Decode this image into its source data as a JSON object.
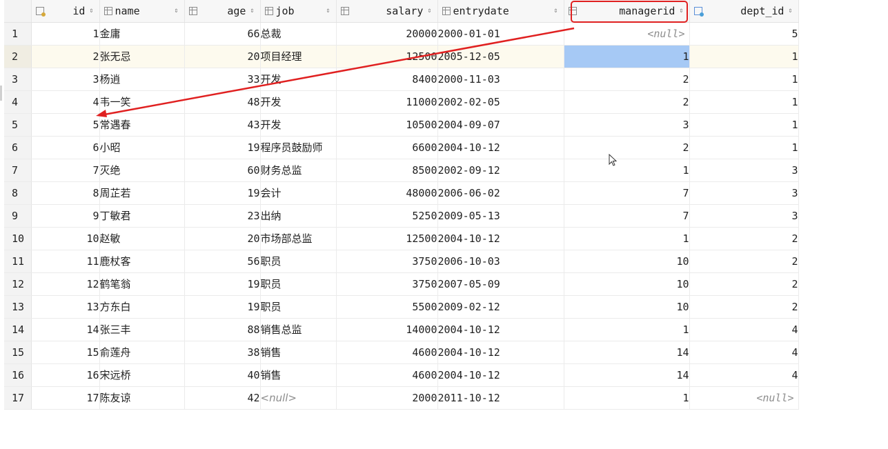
{
  "columns": [
    {
      "name": "id",
      "icon": "primary-key-column-icon"
    },
    {
      "name": "name",
      "icon": "column-icon"
    },
    {
      "name": "age",
      "icon": "column-icon"
    },
    {
      "name": "job",
      "icon": "column-icon"
    },
    {
      "name": "salary",
      "icon": "column-icon"
    },
    {
      "name": "entrydate",
      "icon": "column-icon"
    },
    {
      "name": "managerid",
      "icon": "column-icon"
    },
    {
      "name": "dept_id",
      "icon": "foreign-key-column-icon"
    }
  ],
  "sort_glyph": "⇕",
  "rows": [
    [
      "1",
      "1",
      "金庸",
      "66",
      "总裁",
      "20000",
      "2000-01-01",
      "<null>",
      "5"
    ],
    [
      "2",
      "2",
      "张无忌",
      "20",
      "项目经理",
      "12500",
      "2005-12-05",
      "1",
      "1"
    ],
    [
      "3",
      "3",
      "杨逍",
      "33",
      "开发",
      "8400",
      "2000-11-03",
      "2",
      "1"
    ],
    [
      "4",
      "4",
      "韦一笑",
      "48",
      "开发",
      "11000",
      "2002-02-05",
      "2",
      "1"
    ],
    [
      "5",
      "5",
      "常遇春",
      "43",
      "开发",
      "10500",
      "2004-09-07",
      "3",
      "1"
    ],
    [
      "6",
      "6",
      "小昭",
      "19",
      "程序员鼓励师",
      "6600",
      "2004-10-12",
      "2",
      "1"
    ],
    [
      "7",
      "7",
      "灭绝",
      "60",
      "财务总监",
      "8500",
      "2002-09-12",
      "1",
      "3"
    ],
    [
      "8",
      "8",
      "周芷若",
      "19",
      "会计",
      "48000",
      "2006-06-02",
      "7",
      "3"
    ],
    [
      "9",
      "9",
      "丁敏君",
      "23",
      "出纳",
      "5250",
      "2009-05-13",
      "7",
      "3"
    ],
    [
      "10",
      "10",
      "赵敏",
      "20",
      "市场部总监",
      "12500",
      "2004-10-12",
      "1",
      "2"
    ],
    [
      "11",
      "11",
      "鹿杖客",
      "56",
      "职员",
      "3750",
      "2006-10-03",
      "10",
      "2"
    ],
    [
      "12",
      "12",
      "鹤笔翁",
      "19",
      "职员",
      "3750",
      "2007-05-09",
      "10",
      "2"
    ],
    [
      "13",
      "13",
      "方东白",
      "19",
      "职员",
      "5500",
      "2009-02-12",
      "10",
      "2"
    ],
    [
      "14",
      "14",
      "张三丰",
      "88",
      "销售总监",
      "14000",
      "2004-10-12",
      "1",
      "4"
    ],
    [
      "15",
      "15",
      "俞莲舟",
      "38",
      "销售",
      "4600",
      "2004-10-12",
      "14",
      "4"
    ],
    [
      "16",
      "16",
      "宋远桥",
      "40",
      "销售",
      "4600",
      "2004-10-12",
      "14",
      "4"
    ],
    [
      "17",
      "17",
      "陈友谅",
      "42",
      "<null>",
      "2000",
      "2011-10-12",
      "1",
      "<null>"
    ]
  ],
  "highlighted_row": 2,
  "selected_cell": {
    "row": 2,
    "column": "managerid"
  },
  "annotation": {
    "color": "#e02020",
    "target_column": "managerid"
  }
}
